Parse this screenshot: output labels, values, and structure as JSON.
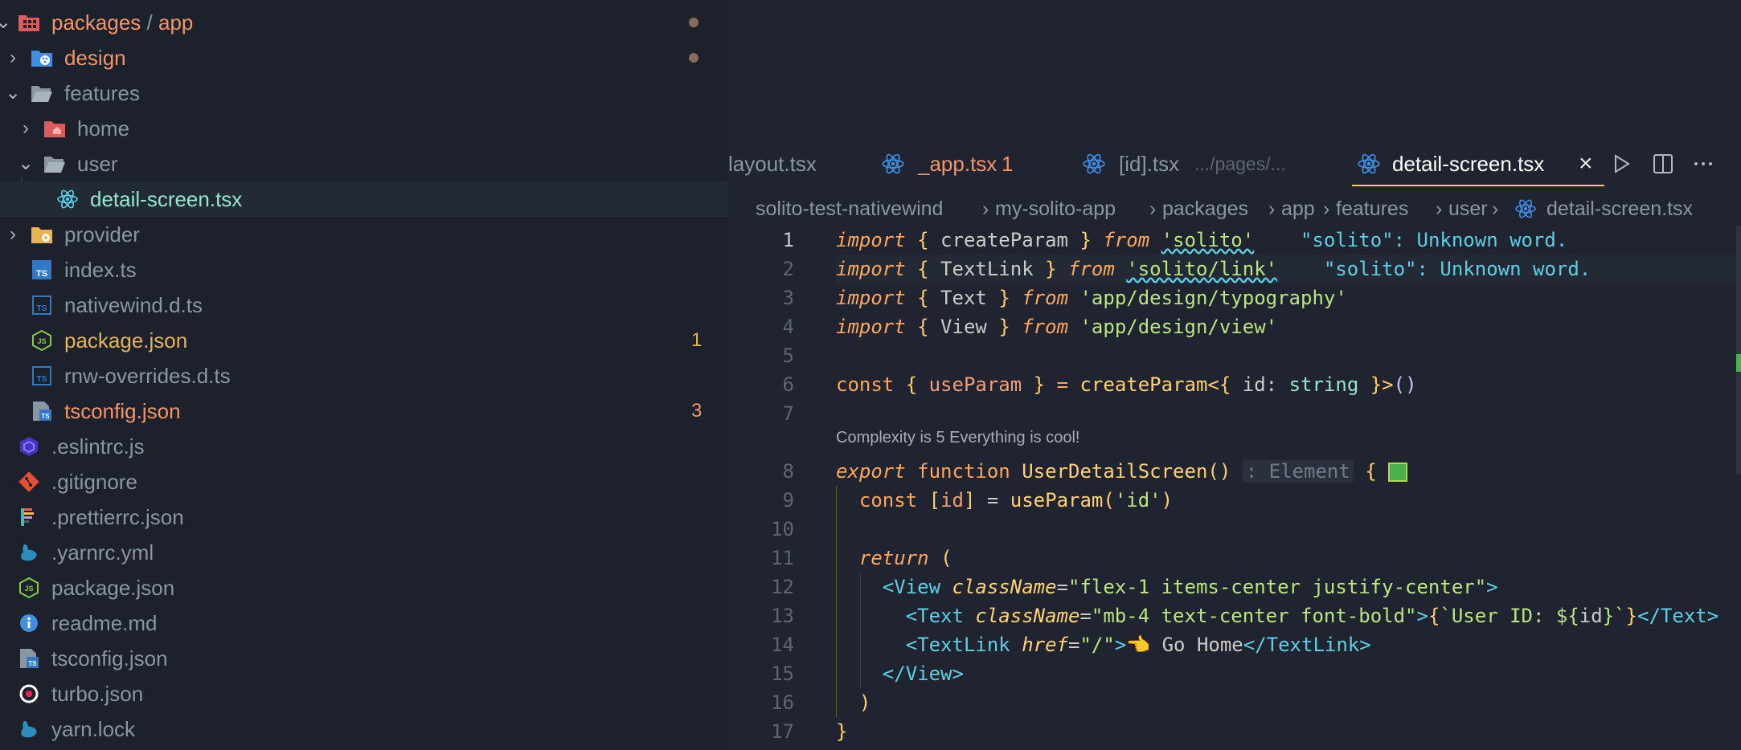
{
  "explorer": {
    "rows": [
      {
        "label": "packages",
        "sep": "/",
        "sub": "app"
      },
      {
        "label": "design"
      },
      {
        "label": "features"
      },
      {
        "label": "home"
      },
      {
        "label": "user"
      },
      {
        "label": "detail-screen.tsx"
      },
      {
        "label": "provider"
      },
      {
        "label": "index.ts"
      },
      {
        "label": "nativewind.d.ts"
      },
      {
        "label": "package.json",
        "badge": "1"
      },
      {
        "label": "rnw-overrides.d.ts"
      },
      {
        "label": "tsconfig.json",
        "badge": "3"
      },
      {
        "label": ".eslintrc.js"
      },
      {
        "label": ".gitignore"
      },
      {
        "label": ".prettierrc.json"
      },
      {
        "label": ".yarnrc.yml"
      },
      {
        "label": "package.json"
      },
      {
        "label": "readme.md"
      },
      {
        "label": "tsconfig.json"
      },
      {
        "label": "turbo.json"
      },
      {
        "label": "yarn.lock"
      }
    ]
  },
  "tabs": [
    {
      "label": "layout.tsx"
    },
    {
      "label": "_app.tsx",
      "badge": "1"
    },
    {
      "label": "[id].tsx",
      "desc": ".../pages/..."
    },
    {
      "label": "detail-screen.tsx"
    }
  ],
  "breadcrumb": [
    "solito-test-nativewind",
    "my-solito-app",
    "packages",
    "app",
    "features",
    "user",
    "detail-screen.tsx"
  ],
  "code": {
    "line_numbers": [
      "1",
      "2",
      "3",
      "4",
      "5",
      "6",
      "7",
      "8",
      "9",
      "10",
      "11",
      "12",
      "13",
      "14",
      "15",
      "16",
      "17"
    ],
    "complexity_hint": "Complexity is 5 Everything is cool!",
    "l1": {
      "a": "import",
      "b": "{",
      "c": " createParam ",
      "d": "}",
      "e": "from",
      "f": "'solito'",
      "err": "\"solito\": Unknown word."
    },
    "l2": {
      "a": "import",
      "b": "{",
      "c": " TextLink ",
      "d": "}",
      "e": "from",
      "f": "'solito/link'",
      "err": "\"solito\": Unknown word."
    },
    "l3": {
      "a": "import",
      "b": "{",
      "c": " Text ",
      "d": "}",
      "e": "from",
      "f": "'app/design/typography'"
    },
    "l4": {
      "a": "import",
      "b": "{",
      "c": " View ",
      "d": "}",
      "e": "from",
      "f": "'app/design/view'"
    },
    "l6": {
      "a": "const",
      "b": "{",
      "c": "useParam",
      "d": "}",
      "e": "=",
      "f": "createParam",
      "g": "<{",
      "h": " id: ",
      "i": "string",
      "j": " }>",
      "k": "()"
    },
    "l8": {
      "a": "export",
      "b": "function",
      "c": "UserDetailScreen",
      "d": "()",
      "e": ": Element",
      "f": "{"
    },
    "l9": {
      "a": "const",
      "b": "[",
      "c": "id",
      "d": "]",
      "e": " = ",
      "f": "useParam",
      "g": "(",
      "h": "'id'",
      "i": ")"
    },
    "l11": {
      "a": "return",
      "b": "("
    },
    "l12": {
      "a": "<",
      "b": "View",
      "c": "className",
      "d": "=",
      "e": "\"flex-1 items-center justify-center\"",
      "f": ">"
    },
    "l13": {
      "a": "<",
      "b": "Text",
      "c": "className",
      "d": "=",
      "e": "\"mb-4 text-center font-bold\"",
      "f": ">",
      "g": "{",
      "h": "`User ID: ${",
      "i": "id",
      "j": "}`",
      "k": "}",
      "l": "</",
      "m": "Text",
      "n": ">"
    },
    "l14": {
      "a": "<",
      "b": "TextLink",
      "c": "href",
      "d": "=",
      "e": "\"/\"",
      "f": ">",
      "g": "👈 Go Home",
      "h": "</",
      "i": "TextLink",
      "j": ">"
    },
    "l15": {
      "a": "</",
      "b": "View",
      "c": ">"
    },
    "l16": {
      "a": ")"
    },
    "l17": {
      "a": "}"
    }
  }
}
